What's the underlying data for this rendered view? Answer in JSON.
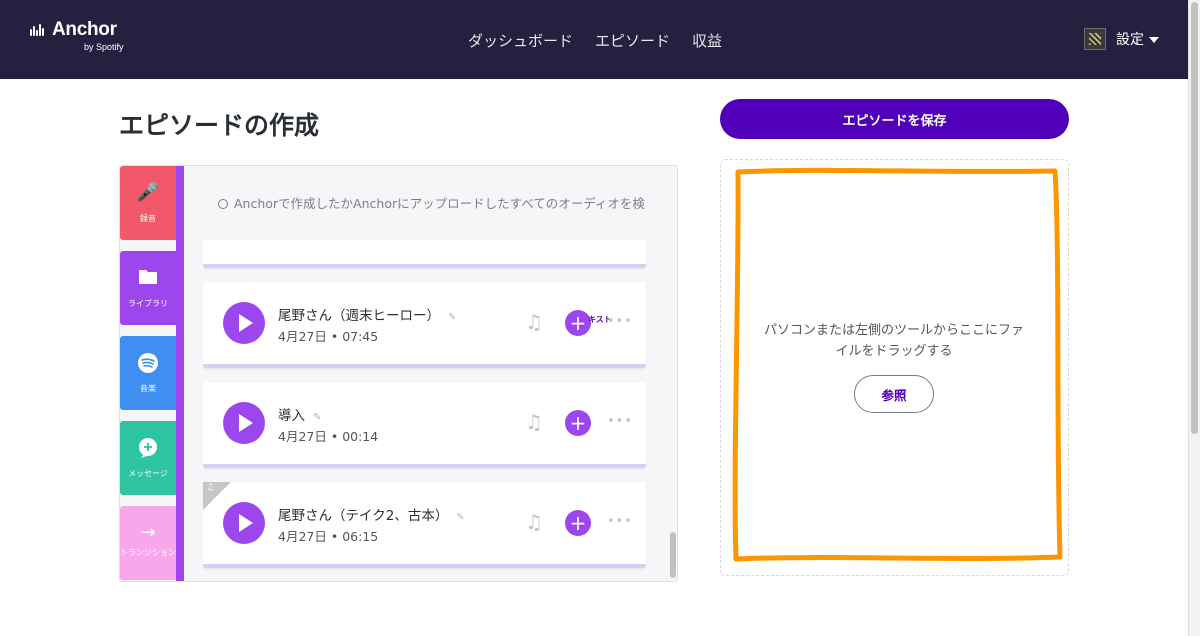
{
  "header": {
    "logo_word": "Anchor",
    "logo_sub": "by Spotify",
    "nav": [
      "ダッシュボード",
      "エピソード",
      "収益"
    ],
    "settings_label": "設定"
  },
  "page": {
    "title": "エピソードの作成",
    "save_label": "エピソードを保存"
  },
  "tools": {
    "record": "録音",
    "library": "ライブラリ",
    "music": "音楽",
    "message": "メッセージ",
    "transition": "トランジション"
  },
  "search": {
    "placeholder": "Anchorで作成したかAnchorにアップロードしたすべてのオーディオを検"
  },
  "episodes": [
    {
      "title": "尾野さん（週末ヒーロー）",
      "date": "4月27日",
      "duration": "07:45",
      "ticker": "キスト"
    },
    {
      "title": "導入",
      "date": "4月27日",
      "duration": "00:14"
    },
    {
      "title": "尾野さん（テイク2、古本）",
      "date": "4月27日",
      "duration": "06:15"
    }
  ],
  "dropzone": {
    "text": "パソコンまたは左側のツールからここにファイルをドラッグする",
    "browse_label": "参照"
  },
  "colors": {
    "nav_bg": "#25203f",
    "accent": "#5000b9",
    "purple": "#9c46ed",
    "record": "#f1586a",
    "music": "#3f8ff2",
    "message": "#2ec4a1",
    "transition": "#f9a7ed",
    "annotation": "#ff9600"
  }
}
